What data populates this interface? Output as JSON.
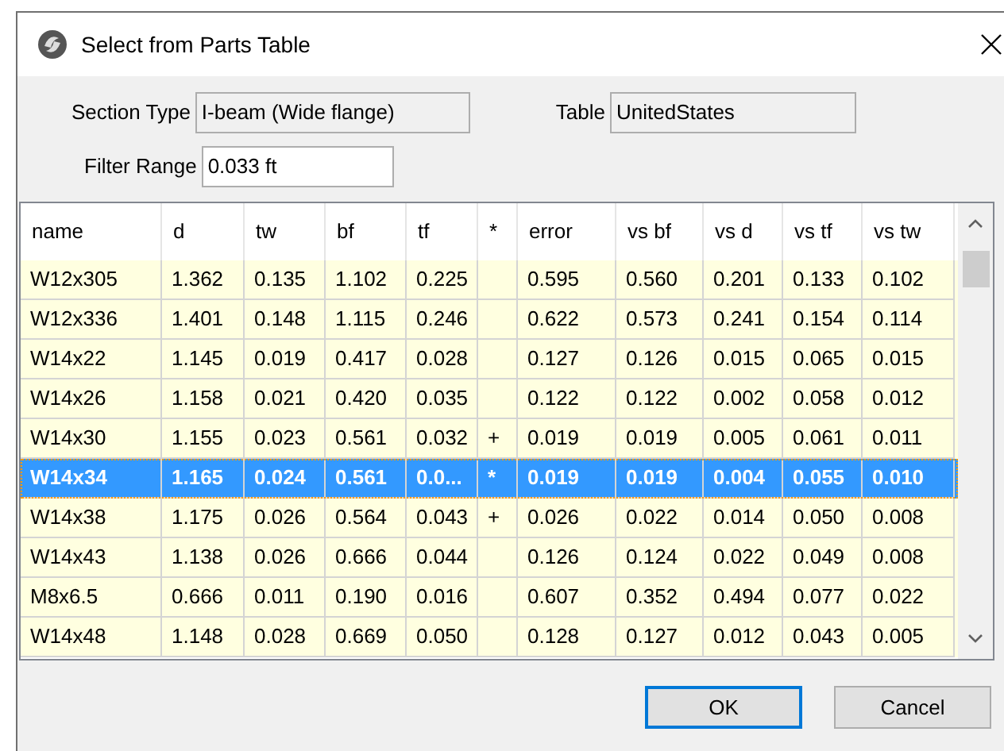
{
  "window": {
    "title": "Select from Parts Table"
  },
  "fields": {
    "section_type": {
      "label": "Section Type",
      "value": "I-beam (Wide flange)"
    },
    "table": {
      "label": "Table",
      "value": "UnitedStates"
    },
    "filter_range": {
      "label": "Filter Range",
      "value": "0.033 ft"
    }
  },
  "table": {
    "columns": [
      "name",
      "d",
      "tw",
      "bf",
      "tf",
      "*",
      "error",
      "vs bf",
      "vs d",
      "vs tf",
      "vs tw"
    ],
    "rows": [
      {
        "selected": false,
        "cells": [
          "W12x305",
          "1.362",
          "0.135",
          "1.102",
          "0.225",
          "",
          "0.595",
          "0.560",
          "0.201",
          "0.133",
          "0.102"
        ]
      },
      {
        "selected": false,
        "cells": [
          "W12x336",
          "1.401",
          "0.148",
          "1.115",
          "0.246",
          "",
          "0.622",
          "0.573",
          "0.241",
          "0.154",
          "0.114"
        ]
      },
      {
        "selected": false,
        "cells": [
          "W14x22",
          "1.145",
          "0.019",
          "0.417",
          "0.028",
          "",
          "0.127",
          "0.126",
          "0.015",
          "0.065",
          "0.015"
        ]
      },
      {
        "selected": false,
        "cells": [
          "W14x26",
          "1.158",
          "0.021",
          "0.420",
          "0.035",
          "",
          "0.122",
          "0.122",
          "0.002",
          "0.058",
          "0.012"
        ]
      },
      {
        "selected": false,
        "cells": [
          "W14x30",
          "1.155",
          "0.023",
          "0.561",
          "0.032",
          "+",
          "0.019",
          "0.019",
          "0.005",
          "0.061",
          "0.011"
        ]
      },
      {
        "selected": true,
        "cells": [
          "W14x34",
          "1.165",
          "0.024",
          "0.561",
          "0.0...",
          "*",
          "0.019",
          "0.019",
          "0.004",
          "0.055",
          "0.010"
        ]
      },
      {
        "selected": false,
        "cells": [
          "W14x38",
          "1.175",
          "0.026",
          "0.564",
          "0.043",
          "+",
          "0.026",
          "0.022",
          "0.014",
          "0.050",
          "0.008"
        ]
      },
      {
        "selected": false,
        "cells": [
          "W14x43",
          "1.138",
          "0.026",
          "0.666",
          "0.044",
          "",
          "0.126",
          "0.124",
          "0.022",
          "0.049",
          "0.008"
        ]
      },
      {
        "selected": false,
        "cells": [
          "M8x6.5",
          "0.666",
          "0.011",
          "0.190",
          "0.016",
          "",
          "0.607",
          "0.352",
          "0.494",
          "0.077",
          "0.022"
        ]
      },
      {
        "selected": false,
        "cells": [
          "W14x48",
          "1.148",
          "0.028",
          "0.669",
          "0.050",
          "",
          "0.128",
          "0.127",
          "0.012",
          "0.043",
          "0.005"
        ]
      }
    ]
  },
  "buttons": [
    {
      "label": "OK",
      "default": true
    },
    {
      "label": "Cancel",
      "default": false
    }
  ]
}
